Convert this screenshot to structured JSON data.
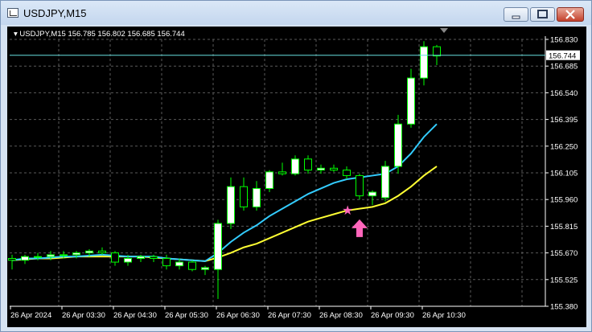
{
  "window": {
    "title": "USDJPY,M15",
    "controls": [
      {
        "name": "minimize-button",
        "icon": "minimize-icon"
      },
      {
        "name": "maximize-button",
        "icon": "maximize-icon"
      },
      {
        "name": "close-button",
        "icon": "close-icon"
      }
    ]
  },
  "chart": {
    "symbol_info": "USDJPY,M15",
    "ohlc": "156.785 156.802 156.685 156.744",
    "current_price": "156.744",
    "colors": {
      "background": "#000000",
      "grid": "#5a5a5a",
      "bull_body": "#ffffff",
      "bear_body": "#000000",
      "wick": "#00ff00",
      "ma_fast": "#33ccff",
      "ma_slow": "#ffff33",
      "star": "#ff66bb",
      "arrow": "#ff66bb",
      "price_line": "#66dddd"
    }
  },
  "chart_data": {
    "type": "candlestick",
    "x_ticks": [
      "26 Apr 2024",
      "26 Apr 03:30",
      "26 Apr 04:30",
      "26 Apr 05:30",
      "26 Apr 06:30",
      "26 Apr 07:30",
      "26 Apr 08:30",
      "26 Apr 09:30",
      "26 Apr 10:30"
    ],
    "y_ticks": [
      "156.830",
      "156.685",
      "156.540",
      "156.395",
      "156.250",
      "156.105",
      "155.960",
      "155.815",
      "155.670",
      "155.525",
      "155.380"
    ],
    "ylim": [
      155.38,
      156.83
    ],
    "candles": [
      [
        155.64,
        155.66,
        155.58,
        155.63
      ],
      [
        155.63,
        155.66,
        155.61,
        155.65
      ],
      [
        155.65,
        155.67,
        155.63,
        155.65
      ],
      [
        155.65,
        155.68,
        155.63,
        155.66
      ],
      [
        155.66,
        155.68,
        155.64,
        155.66
      ],
      [
        155.66,
        155.68,
        155.64,
        155.67
      ],
      [
        155.67,
        155.69,
        155.65,
        155.68
      ],
      [
        155.68,
        155.7,
        155.66,
        155.67
      ],
      [
        155.67,
        155.68,
        155.6,
        155.62
      ],
      [
        155.62,
        155.66,
        155.6,
        155.64
      ],
      [
        155.64,
        155.66,
        155.62,
        155.65
      ],
      [
        155.65,
        155.66,
        155.62,
        155.64
      ],
      [
        155.64,
        155.66,
        155.58,
        155.6
      ],
      [
        155.6,
        155.64,
        155.58,
        155.62
      ],
      [
        155.62,
        155.63,
        155.57,
        155.58
      ],
      [
        155.58,
        155.6,
        155.55,
        155.59
      ],
      [
        155.58,
        155.85,
        155.42,
        155.83
      ],
      [
        155.83,
        156.08,
        155.8,
        156.03
      ],
      [
        156.03,
        156.08,
        155.9,
        155.92
      ],
      [
        155.92,
        156.06,
        155.9,
        156.02
      ],
      [
        156.02,
        156.12,
        156.0,
        156.11
      ],
      [
        156.11,
        156.16,
        156.09,
        156.1
      ],
      [
        156.1,
        156.2,
        156.09,
        156.18
      ],
      [
        156.18,
        156.2,
        156.1,
        156.12
      ],
      [
        156.12,
        156.15,
        156.1,
        156.13
      ],
      [
        156.13,
        156.15,
        156.11,
        156.12
      ],
      [
        156.12,
        156.14,
        156.07,
        156.09
      ],
      [
        156.09,
        156.1,
        155.96,
        155.98
      ],
      [
        155.98,
        156.01,
        155.93,
        156.0
      ],
      [
        155.97,
        156.17,
        155.95,
        156.14
      ],
      [
        156.14,
        156.42,
        156.1,
        156.37
      ],
      [
        156.37,
        156.67,
        156.35,
        156.62
      ],
      [
        156.62,
        156.82,
        156.58,
        156.79
      ],
      [
        156.79,
        156.8,
        156.69,
        156.74
      ]
    ],
    "ma_fast": [
      155.63,
      155.64,
      155.64,
      155.645,
      155.65,
      155.65,
      155.655,
      155.66,
      155.655,
      155.65,
      155.65,
      155.65,
      155.64,
      155.635,
      155.63,
      155.625,
      155.67,
      155.73,
      155.78,
      155.82,
      155.87,
      155.91,
      155.95,
      155.99,
      156.02,
      156.05,
      156.07,
      156.08,
      156.09,
      156.1,
      156.14,
      156.21,
      156.3,
      156.37
    ],
    "ma_slow": [
      155.63,
      155.635,
      155.64,
      155.64,
      155.645,
      155.65,
      155.65,
      155.65,
      155.65,
      155.65,
      155.65,
      155.645,
      155.64,
      155.635,
      155.63,
      155.625,
      155.645,
      155.67,
      155.7,
      155.72,
      155.75,
      155.78,
      155.81,
      155.84,
      155.86,
      155.88,
      155.9,
      155.91,
      155.92,
      155.94,
      155.98,
      156.03,
      156.09,
      156.14
    ],
    "markers": [
      {
        "type": "star",
        "index": 26,
        "price": 155.9
      },
      {
        "type": "arrow-up",
        "index": 27,
        "price": 155.8
      }
    ]
  }
}
